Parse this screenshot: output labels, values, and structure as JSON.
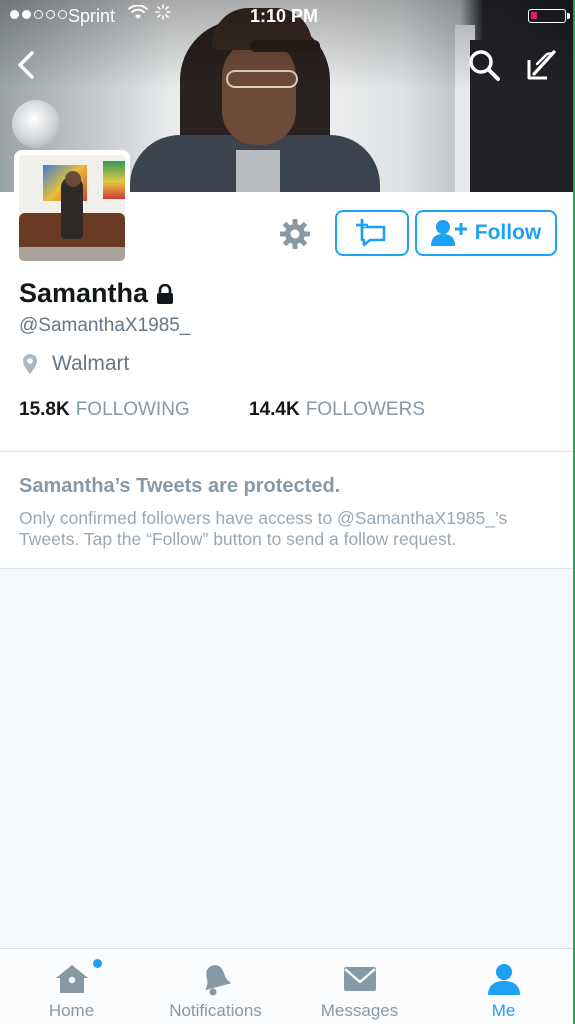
{
  "status_bar": {
    "carrier": "Sprint",
    "time": "1:10 PM",
    "signal_bars_filled": 2,
    "signal_bars_total": 5
  },
  "header": {
    "back_icon": "chevron-left-icon",
    "search_icon": "search-icon",
    "compose_icon": "compose-icon"
  },
  "profile": {
    "display_name": "Samantha",
    "handle": "@SamanthaX1985_",
    "location": "Walmart",
    "follow_label": "Follow",
    "following_count": "15.8K",
    "following_label": "FOLLOWING",
    "followers_count": "14.4K",
    "followers_label": "FOLLOWERS"
  },
  "protected": {
    "title": "Samantha’s Tweets are protected.",
    "body": "Only confirmed followers have access to @SamanthaX1985_’s Tweets. Tap the “Follow” button to send a follow request."
  },
  "tabs": [
    {
      "label": "Home",
      "icon": "home-icon"
    },
    {
      "label": "Notifications",
      "icon": "bell-icon"
    },
    {
      "label": "Messages",
      "icon": "envelope-icon"
    },
    {
      "label": "Me",
      "icon": "person-icon"
    }
  ],
  "colors": {
    "accent": "#1da1f2",
    "text_primary": "#14171a",
    "text_secondary": "#657786",
    "text_muted": "#8899a6",
    "background": "#f5f8fa"
  }
}
